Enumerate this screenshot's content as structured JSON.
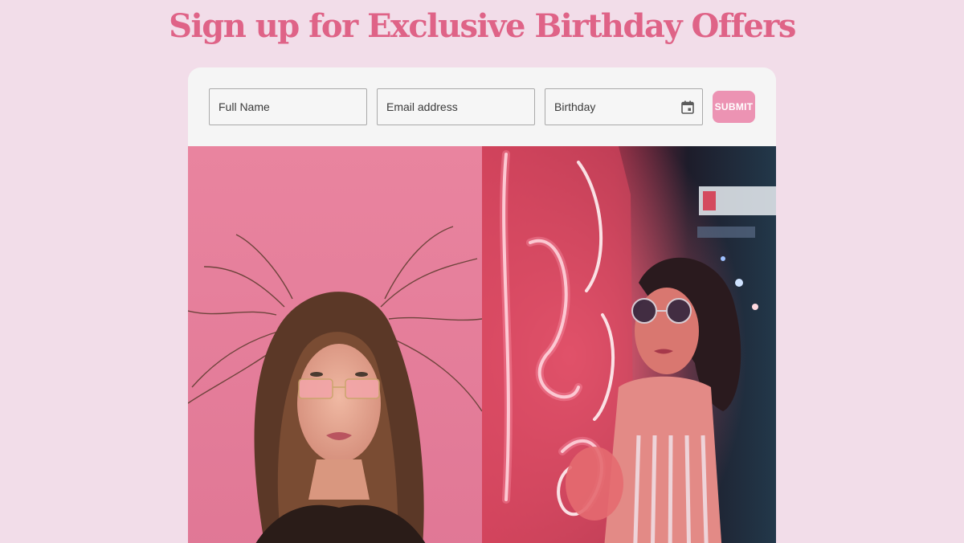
{
  "heading": "Sign up for Exclusive Birthday Offers",
  "form": {
    "name_placeholder": "Full Name",
    "email_placeholder": "Email address",
    "birthday_placeholder": "Birthday",
    "submit_label": "SUBMIT",
    "calendar_icon": "calendar-icon"
  },
  "photos": [
    {
      "subject": "woman with long hair and pink-tinted glasses against a pink wall"
    },
    {
      "subject": "woman in round sunglasses beside a pink neon sign at night"
    }
  ],
  "colors": {
    "page_background": "#f2dde9",
    "heading": "#df6387",
    "card": "#f5f5f5",
    "submit_button": "#ec93b3"
  }
}
